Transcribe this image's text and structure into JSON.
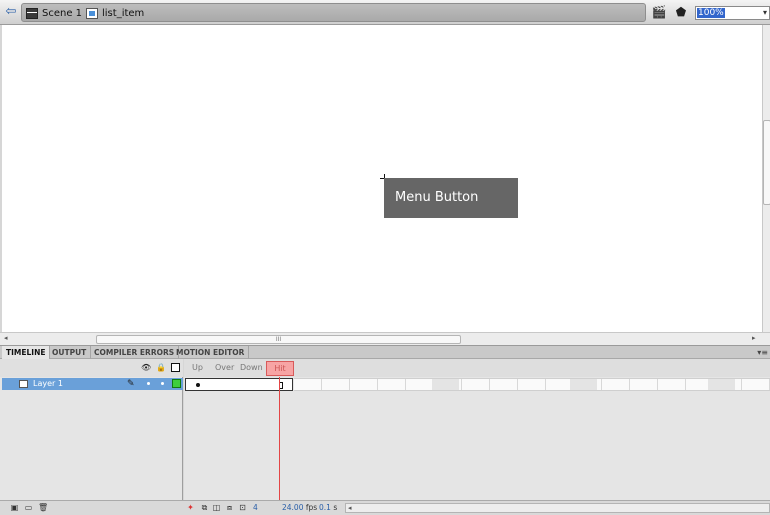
{
  "editbar": {
    "breadcrumbs": [
      {
        "label": "Scene 1",
        "icon": "clapperboard-icon"
      },
      {
        "label": "list_item",
        "icon": "symbol-icon"
      }
    ],
    "zoom": "100%"
  },
  "stage": {
    "button_label": "Menu Button",
    "hscroll_grip": "III"
  },
  "panel": {
    "tabs": [
      "TIMELINE",
      "OUTPUT",
      "COMPILER ERRORS",
      "MOTION EDITOR"
    ]
  },
  "timeline": {
    "layer_name": "Layer 1",
    "frame_labels": [
      "Up",
      "Over",
      "Down",
      "Hit"
    ],
    "outline_color": "#3ecf3e",
    "playhead_color": "#e34545"
  },
  "status": {
    "current_frame": "4",
    "fps": "24.00",
    "fps_unit": "fps",
    "time": "0.1",
    "time_unit": "s"
  }
}
